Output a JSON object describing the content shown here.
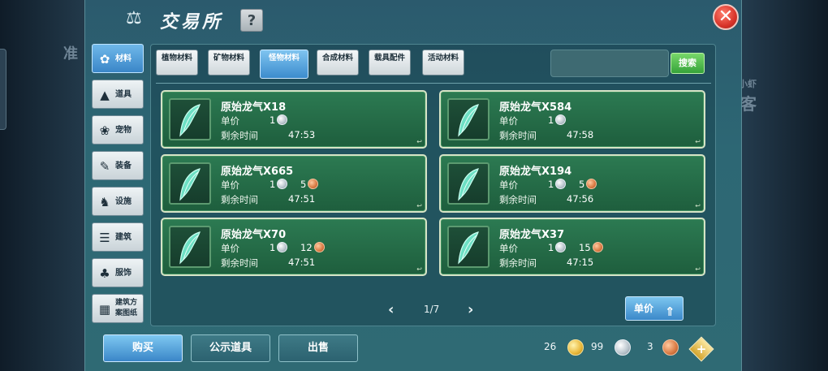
{
  "title": "交易所",
  "help_label": "?",
  "close_label": "✕",
  "background_text": {
    "left": "准",
    "right_small": "小虾",
    "right": "客"
  },
  "sidebar": {
    "items": [
      {
        "label": "材料",
        "icon": "paw-cluster-icon",
        "active": true
      },
      {
        "label": "道具",
        "icon": "flask-icon",
        "active": false
      },
      {
        "label": "宠物",
        "icon": "paw-icon",
        "active": false
      },
      {
        "label": "装备",
        "icon": "pen-icon",
        "active": false
      },
      {
        "label": "设施",
        "icon": "horse-icon",
        "active": false
      },
      {
        "label": "建筑",
        "icon": "wall-icon",
        "active": false
      },
      {
        "label": "服饰",
        "icon": "clothes-icon",
        "active": false
      },
      {
        "label": "建筑方案图纸",
        "icon": "blueprint-icon",
        "active": false
      }
    ]
  },
  "tabs": [
    {
      "label": "植物材料",
      "active": false
    },
    {
      "label": "矿物材料",
      "active": false
    },
    {
      "label": "怪物材料",
      "active": true
    },
    {
      "label": "合成材料",
      "active": false
    },
    {
      "label": "载具配件",
      "active": false
    },
    {
      "label": "活动材料",
      "active": false
    }
  ],
  "search": {
    "placeholder": "",
    "button_label": "搜索"
  },
  "listing_labels": {
    "price": "单价",
    "time": "剩余时间"
  },
  "listings": [
    {
      "name": "原始龙气X18",
      "silver": "1",
      "copper": "",
      "time": "47:53"
    },
    {
      "name": "原始龙气X584",
      "silver": "1",
      "copper": "",
      "time": "47:58"
    },
    {
      "name": "原始龙气X665",
      "silver": "1",
      "copper": "5",
      "time": "47:51"
    },
    {
      "name": "原始龙气X194",
      "silver": "1",
      "copper": "5",
      "time": "47:56"
    },
    {
      "name": "原始龙气X70",
      "silver": "1",
      "copper": "12",
      "time": "47:51"
    },
    {
      "name": "原始龙气X37",
      "silver": "1",
      "copper": "15",
      "time": "47:15"
    }
  ],
  "pagination": {
    "prev": "‹",
    "page": "1/7",
    "next": "›"
  },
  "sort_button": {
    "label": "单价",
    "icon": "sort-up-icon"
  },
  "bottom": {
    "buy_label": "购买",
    "public_label": "公示道具",
    "sell_label": "出售"
  },
  "currency": {
    "gold": "26",
    "silver": "99",
    "copper": "3",
    "add_label": "+"
  },
  "colors": {
    "accent_blue": "#3a86c8",
    "listing_green": "#2c7a52",
    "search_green": "#36a33a",
    "close_red": "#d8342a"
  }
}
